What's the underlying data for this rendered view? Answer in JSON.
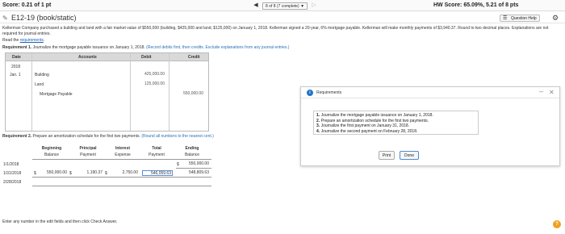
{
  "topbar": {
    "score": "Score: 0.21 of 1 pt",
    "question_selector": "8 of 8 (7 complete) ▼",
    "hw_score": "HW Score: 65.09%, 5.21 of 8 pts"
  },
  "title": {
    "text": "E12-19 (book/static)",
    "help_label": "Question Help"
  },
  "problem": {
    "text": "Kellerman Company purchased a building and land with a fair market value of $550,000 (building, $425,000 and land, $125,000) on January 1, 2018. Kellerman signed a 20-year, 6% mortgage payable. Kellerman will make monthly payments of $3,940.37. Round to two decimal places. Explanations are not required for journal entries.",
    "read_prefix": "Read the ",
    "read_link": "requirements",
    "read_suffix": "."
  },
  "req1": {
    "label": "Requirement 1.",
    "text": " Journalize the mortgage payable issuance on January 1, 2018. ",
    "hint": "(Record debits first, then credits. Exclude explanations from any journal entries.)"
  },
  "journal": {
    "headers": {
      "date": "Date",
      "accounts": "Accounts",
      "debit": "Debit",
      "credit": "Credit"
    },
    "year": "2018",
    "date": "Jan. 1",
    "rows": [
      {
        "account": "Building",
        "debit": "425,000.00",
        "credit": ""
      },
      {
        "account": "Land",
        "debit": "125,000.00",
        "credit": ""
      },
      {
        "account": "Mortgage Payable",
        "debit": "",
        "credit": "550,000.00"
      }
    ]
  },
  "req2": {
    "label": "Requirement 2.",
    "text": " Prepare an amortization schedule for the first two payments. ",
    "hint": "(Round all numbers to the nearest cent.)"
  },
  "amortization": {
    "headers": [
      {
        "top": "Beginning",
        "bottom": "Balance"
      },
      {
        "top": "Principal",
        "bottom": "Payment"
      },
      {
        "top": "Interest",
        "bottom": "Expense"
      },
      {
        "top": "Total",
        "bottom": "Payment"
      },
      {
        "top": "Ending",
        "bottom": "Balance"
      }
    ],
    "rows": [
      {
        "date": "1/1/2018",
        "beginning": "",
        "principal": "",
        "interest": "",
        "total": "",
        "ending": "550,000.00"
      },
      {
        "date": "1/31/2018",
        "beginning": "550,000.00",
        "principal": "1,190.37",
        "interest": "2,750.00",
        "total": "546,059.63",
        "ending": "548,809.63"
      },
      {
        "date": "2/28/2018",
        "beginning": "",
        "principal": "",
        "interest": "",
        "total": "",
        "ending": ""
      }
    ],
    "currency": "$"
  },
  "modal": {
    "title": "Requirements",
    "items": [
      {
        "num": "1.",
        "text": "Journalize the mortgage payable issuance on January 1, 2018."
      },
      {
        "num": "2.",
        "text": "Prepare an amortization schedule for the first two payments."
      },
      {
        "num": "3.",
        "text": "Journalize the first payment on January 31, 2018."
      },
      {
        "num": "4.",
        "text": "Journalize the second payment on February 28, 2018."
      }
    ],
    "print_label": "Print",
    "done_label": "Done"
  },
  "footer": {
    "instruction": "Enter any number in the edit fields and then click Check Answer.",
    "help_icon": "?"
  }
}
